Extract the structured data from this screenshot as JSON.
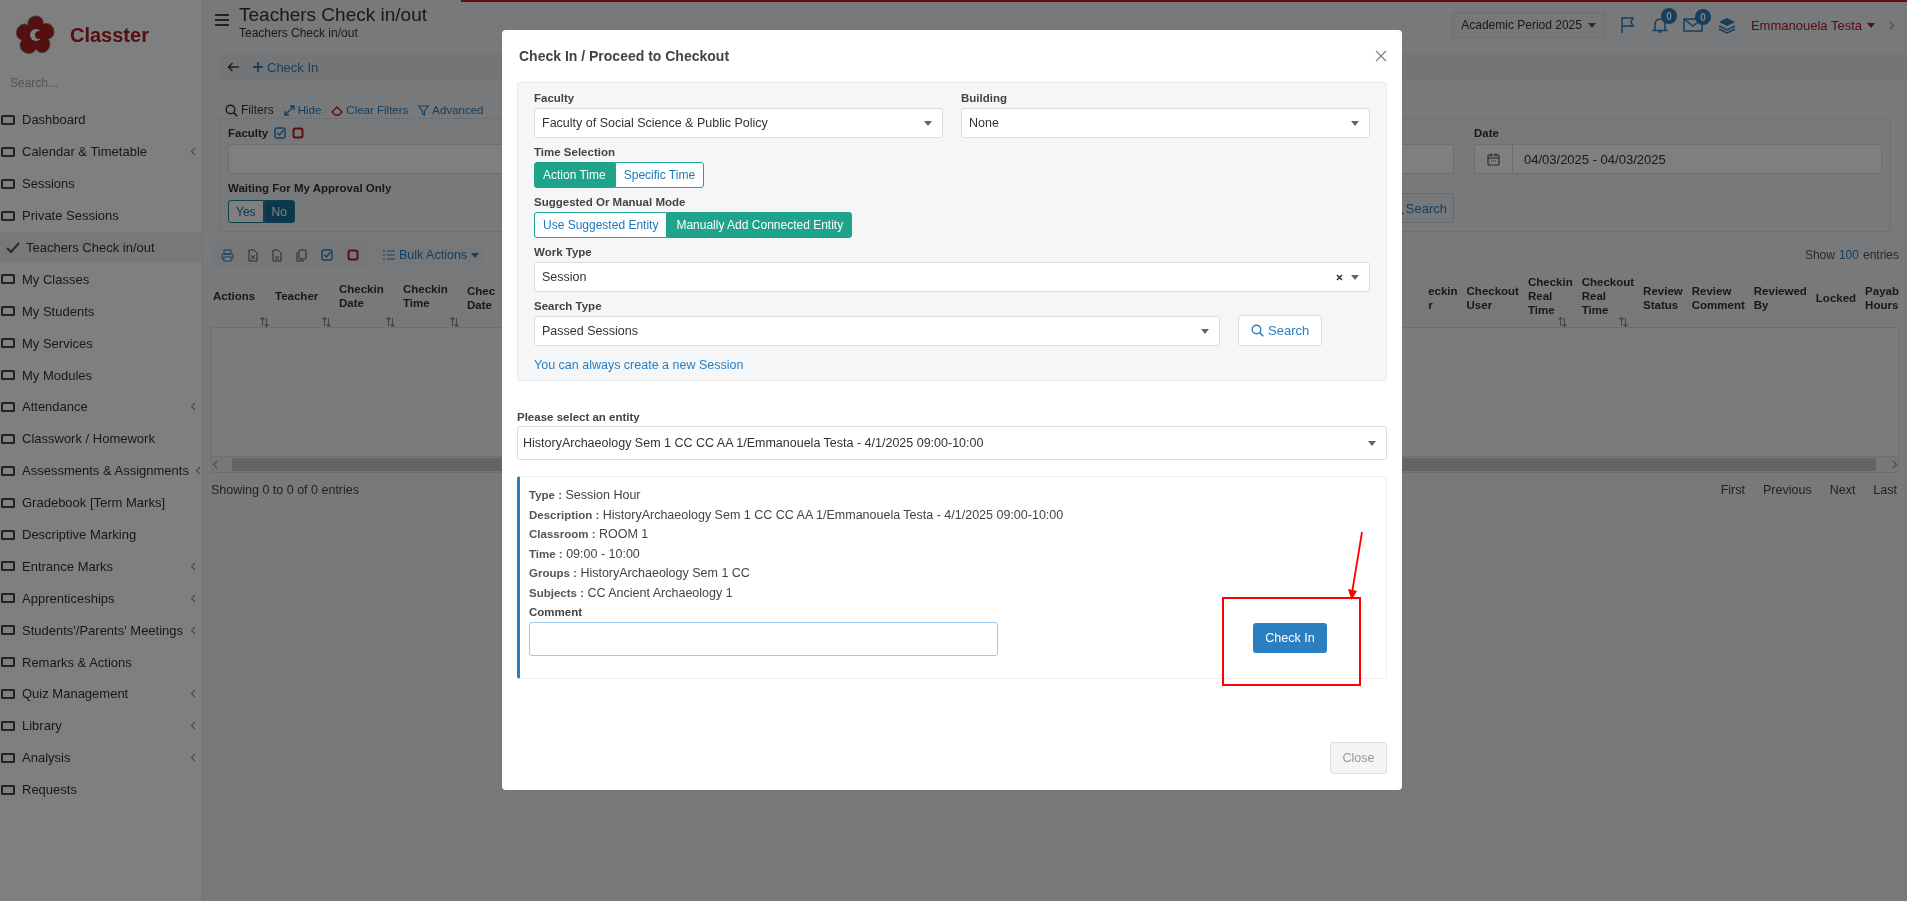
{
  "sidebar": {
    "logo": "Classter",
    "search_placeholder": "Search...",
    "items": [
      {
        "label": "Dashboard",
        "selected": false,
        "expandable": false
      },
      {
        "label": "Calendar & Timetable",
        "selected": false,
        "expandable": true
      },
      {
        "label": "Sessions",
        "selected": false,
        "expandable": false
      },
      {
        "label": "Private Sessions",
        "selected": false,
        "expandable": false
      },
      {
        "label": "Teachers Check in/out",
        "selected": true,
        "expandable": false
      },
      {
        "label": "My Classes",
        "selected": false,
        "expandable": false
      },
      {
        "label": "My Students",
        "selected": false,
        "expandable": false
      },
      {
        "label": "My Services",
        "selected": false,
        "expandable": false
      },
      {
        "label": "My Modules",
        "selected": false,
        "expandable": false
      },
      {
        "label": "Attendance",
        "selected": false,
        "expandable": true
      },
      {
        "label": "Classwork / Homework",
        "selected": false,
        "expandable": false
      },
      {
        "label": "Assessments & Assignments",
        "selected": false,
        "expandable": true
      },
      {
        "label": "Gradebook [Term Marks]",
        "selected": false,
        "expandable": false
      },
      {
        "label": "Descriptive Marking",
        "selected": false,
        "expandable": false
      },
      {
        "label": "Entrance Marks",
        "selected": false,
        "expandable": true
      },
      {
        "label": "Apprenticeships",
        "selected": false,
        "expandable": true
      },
      {
        "label": "Students'/Parents' Meetings",
        "selected": false,
        "expandable": true
      },
      {
        "label": "Remarks & Actions",
        "selected": false,
        "expandable": false
      },
      {
        "label": "Quiz Management",
        "selected": false,
        "expandable": true
      },
      {
        "label": "Library",
        "selected": false,
        "expandable": true
      },
      {
        "label": "Analysis",
        "selected": false,
        "expandable": true
      },
      {
        "label": "Requests",
        "selected": false,
        "expandable": false
      }
    ]
  },
  "header": {
    "page_title": "Teachers Check in/out",
    "breadcrumb": "Teachers Check in/out",
    "academic_period": "Academic Period 2025",
    "notifications_count": "0",
    "messages_count": "0",
    "user_name": "Emmanouela Testa",
    "action": "Check In"
  },
  "filters": {
    "links": [
      "Filters",
      "Hide",
      "Clear Filters",
      "Advanced"
    ],
    "faculty_label": "Faculty",
    "approval_label": "Waiting For My Approval Only",
    "approval_options": [
      {
        "label": "Yes",
        "selected": false
      },
      {
        "label": "No",
        "selected": true
      }
    ],
    "date_label": "Date",
    "date_value": "04/03/2025 - 04/03/2025",
    "search": "Search"
  },
  "table": {
    "bulk_actions": "Bulk Actions",
    "show": "Show",
    "page_size": "100",
    "entries": "entries",
    "columns_left": [
      {
        "label": "Actions",
        "sortable": true
      },
      {
        "label": "Teacher",
        "sortable": true
      },
      {
        "label": "Checkin Date",
        "sortable": true
      },
      {
        "label": "Checkin Time",
        "sortable": true
      },
      {
        "label": "Chec Date",
        "sortable": false
      }
    ],
    "columns_right": [
      {
        "label": "eckin r",
        "sortable": false
      },
      {
        "label": "Checkout User",
        "sortable": false
      },
      {
        "label": "Checkin Real Time",
        "sortable": true
      },
      {
        "label": "Checkout Real Time",
        "sortable": true
      },
      {
        "label": "Review Status",
        "sortable": false
      },
      {
        "label": "Review Comment",
        "sortable": false
      },
      {
        "label": "Reviewed By",
        "sortable": false
      },
      {
        "label": "Locked",
        "sortable": false
      },
      {
        "label": "Payab Hours",
        "sortable": false
      }
    ],
    "info": "Showing 0 to 0 of 0 entries",
    "pager": [
      "First",
      "Previous",
      "Next",
      "Last"
    ]
  },
  "modal": {
    "title": "Check In / Proceed to Checkout",
    "faculty_label": "Faculty",
    "faculty_value": "Faculty of Social Science & Public Policy",
    "building_label": "Building",
    "building_value": "None",
    "time_label": "Time Selection",
    "time_options": [
      {
        "label": "Action Time",
        "selected": true
      },
      {
        "label": "Specific Time",
        "selected": false
      }
    ],
    "mode_label": "Suggested Or Manual Mode",
    "mode_options": [
      {
        "label": "Use Suggested Entity",
        "selected": false
      },
      {
        "label": "Manually Add Connected Entity",
        "selected": true
      }
    ],
    "work_type_label": "Work Type",
    "work_type_value": "Session",
    "search_type_label": "Search Type",
    "search_type_value": "Passed Sessions",
    "search": "Search",
    "create_link": "You can always create a new Session",
    "entity_label": "Please select an entity",
    "entity_value": "HistoryArchaeology Sem 1 CC CC AA 1/Emmanouela Testa - 4/1/2025 09:00-10:00",
    "details": [
      "**Type :** Session Hour",
      "**Description :** HistoryArchaeology Sem 1 CC CC AA 1/Emmanouela Testa - 4/1/2025 09:00-10:00",
      "**Classroom :** ROOM 1",
      "**Time :** 09:00 - 10:00",
      "**Groups :** HistoryArchaeology Sem 1 CC",
      "**Subjects :** CC Ancient Archaeology 1"
    ],
    "comment_label": "Comment",
    "check_in": "Check In",
    "close": "Close"
  }
}
